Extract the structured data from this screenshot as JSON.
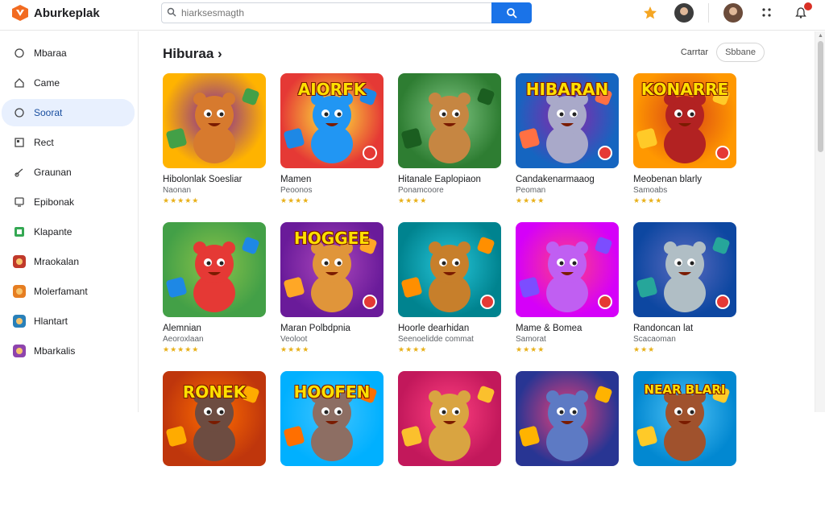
{
  "app": {
    "name": "Aburkeplak"
  },
  "search": {
    "placeholder": "hiarksesmagth"
  },
  "sidebar": {
    "items": [
      {
        "label": "Mbaraa",
        "icon": "circle-icon"
      },
      {
        "label": "Came",
        "icon": "home-icon"
      },
      {
        "label": "Soorat",
        "icon": "circle-icon",
        "active": true
      },
      {
        "label": "Rect",
        "icon": "square-icon"
      },
      {
        "label": "Graunan",
        "icon": "gamepad-icon"
      },
      {
        "label": "Epibonak",
        "icon": "monitor-icon"
      },
      {
        "label": "Klapante",
        "icon": "app-icon"
      },
      {
        "label": "Mraokalan",
        "icon": "game-thumb-icon"
      },
      {
        "label": "Molerfamant",
        "icon": "game-thumb-icon"
      },
      {
        "label": "Hlantart",
        "icon": "game-thumb-icon"
      },
      {
        "label": "Mbarkalis",
        "icon": "game-thumb-icon"
      }
    ]
  },
  "main": {
    "section_title": "Hiburaa",
    "section_arrow": "›",
    "cancel_label": "Carrtar",
    "pill_label": "Sbbane"
  },
  "cards": [
    {
      "title": "Hibolonlak Soesliar",
      "subtitle": "Naonan",
      "stars": "★★★★★",
      "banner": ""
    },
    {
      "title": "Mamen",
      "subtitle": "Peoonos",
      "stars": "★★★★",
      "banner": "AIORFK"
    },
    {
      "title": "Hitanale Eaplopiaon",
      "subtitle": "Ponamcoore",
      "stars": "★★★★",
      "banner": ""
    },
    {
      "title": "Candakenarmaaog",
      "subtitle": "Peoman",
      "stars": "★★★★",
      "banner": "HIBARAN"
    },
    {
      "title": "Meobenan blarly",
      "subtitle": "Samoabs",
      "stars": "★★★★",
      "banner": "KONARRE"
    },
    {
      "title": "Alemnian",
      "subtitle": "Aeoroxlaan",
      "stars": "★★★★★",
      "banner": ""
    },
    {
      "title": "Maran Polbdpnia",
      "subtitle": "Veoloot",
      "stars": "★★★★",
      "banner": "HOGGEE"
    },
    {
      "title": "Hoorle dearhidan",
      "subtitle": "Seenoelidde commat",
      "stars": "★★★★",
      "banner": ""
    },
    {
      "title": "Mame & Bomea",
      "subtitle": "Samorat",
      "stars": "★★★★",
      "banner": ""
    },
    {
      "title": "Randoncan lat",
      "subtitle": "Scacaoman",
      "stars": "★★★",
      "banner": ""
    },
    {
      "title": "",
      "subtitle": "",
      "stars": "",
      "banner": "RONEK"
    },
    {
      "title": "",
      "subtitle": "",
      "stars": "",
      "banner": "HOOFEN"
    },
    {
      "title": "",
      "subtitle": "",
      "stars": "",
      "banner": ""
    },
    {
      "title": "",
      "subtitle": "",
      "stars": "",
      "banner": ""
    },
    {
      "title": "",
      "subtitle": "",
      "stars": "",
      "banner": "NEAR BLARI"
    }
  ],
  "colors": {
    "accent": "#1a73e8",
    "active_bg": "#e8f0fe",
    "star": "#e8b019",
    "logo": "#f26b21"
  }
}
